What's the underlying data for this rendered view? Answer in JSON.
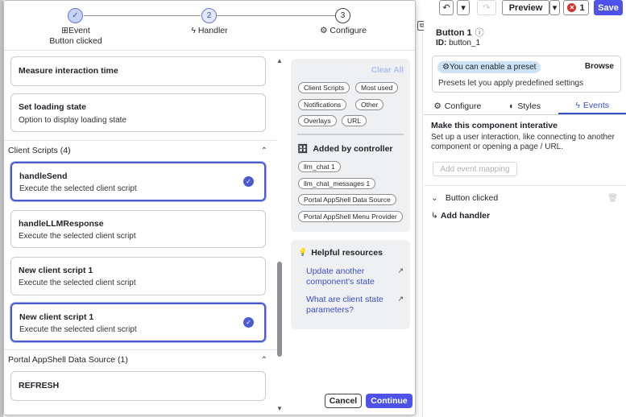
{
  "toolbar": {
    "undo_glyph": "↶",
    "undo_menu_glyph": "▾",
    "redo_glyph": "↷",
    "preview_label": "Preview",
    "preview_menu_glyph": "▾",
    "error_count": "1",
    "save_label": "Save"
  },
  "inspector": {
    "collapse_glyph": "⧉",
    "component_title": "Button 1",
    "info_glyph": "ⓘ",
    "id_label": "ID:",
    "id_value": "button_1",
    "preset": {
      "chip_label": "You can enable a preset",
      "browse_label": "Browse",
      "description": "Presets let you apply predefined settings"
    },
    "tabs": [
      {
        "label": "Configure",
        "icon": "gear-icon",
        "glyph": "⚙"
      },
      {
        "label": "Styles",
        "icon": "palette-icon",
        "glyph": "◐"
      },
      {
        "label": "Events",
        "icon": "bolt-icon",
        "glyph": "ϟ"
      }
    ],
    "active_tab": "Events",
    "events": {
      "title": "Make this component interative",
      "description": "Set up a user interaction, like connecting to another component or opening a page / URL.",
      "add_mapping_label": "Add event mapping",
      "event_name": "Button clicked",
      "add_handler_label": "Add handler",
      "chevron_glyph": "⌄",
      "trash_glyph": "🗑",
      "arrow_glyph": "↳"
    }
  },
  "modal": {
    "steps": [
      {
        "label": "Event",
        "sublabel": "Button clicked",
        "state": "done",
        "number": "✓",
        "icon": "event-icon",
        "glyph": "⊞"
      },
      {
        "label": "Handler",
        "sublabel": "",
        "state": "current",
        "number": "2",
        "icon": "bolt-icon",
        "glyph": "ϟ"
      },
      {
        "label": "Configure",
        "sublabel": "",
        "state": "todo",
        "number": "3",
        "icon": "gear-icon",
        "glyph": "⚙"
      }
    ],
    "cards_top": [
      {
        "title": "Measure interaction time",
        "description": ""
      },
      {
        "title": "Set loading state",
        "description": "Option to display loading state"
      }
    ],
    "client_scripts_header": "Client Scripts (4)",
    "client_scripts": [
      {
        "title": "handleSend",
        "description": "Execute the selected client script",
        "selected": true
      },
      {
        "title": "handleLLMResponse",
        "description": "Execute the selected client script",
        "selected": false
      },
      {
        "title": "New client script 1",
        "description": "Execute the selected client script",
        "selected": false
      },
      {
        "title": "New client script 1",
        "description": "Execute the selected client script",
        "selected": true
      }
    ],
    "data_source_header": "Portal AppShell Data Source (1)",
    "data_source_items": [
      {
        "title": "REFRESH"
      }
    ],
    "caret_glyph": "⌃",
    "check_glyph": "✓",
    "scroll_up_glyph": "▲",
    "scroll_down_glyph": "▼",
    "filters": {
      "clear_all_label": "Clear All",
      "type_chips": [
        "Client Scripts",
        "Most used",
        "Notifications",
        "Other",
        "Overlays",
        "URL"
      ],
      "added_by_controller_label": "Added by controller",
      "controller_chips": [
        "llm_chat 1",
        "llm_chat_messages 1",
        "Portal AppShell Data Source",
        "Portal AppShell Menu Provider"
      ],
      "controller_icon_glyph": "🗄"
    },
    "help": {
      "title": "Helpful resources",
      "bulb_glyph": "💡",
      "ext_glyph": "↗",
      "links": [
        "Update another component's state",
        "What are client state parameters?"
      ]
    },
    "cancel_label": "Cancel",
    "continue_label": "Continue"
  },
  "colors": {
    "accent": "#4f52e8",
    "selected_border": "#4a5bd0",
    "link": "#3a4fc7",
    "error": "#d32f2f"
  }
}
